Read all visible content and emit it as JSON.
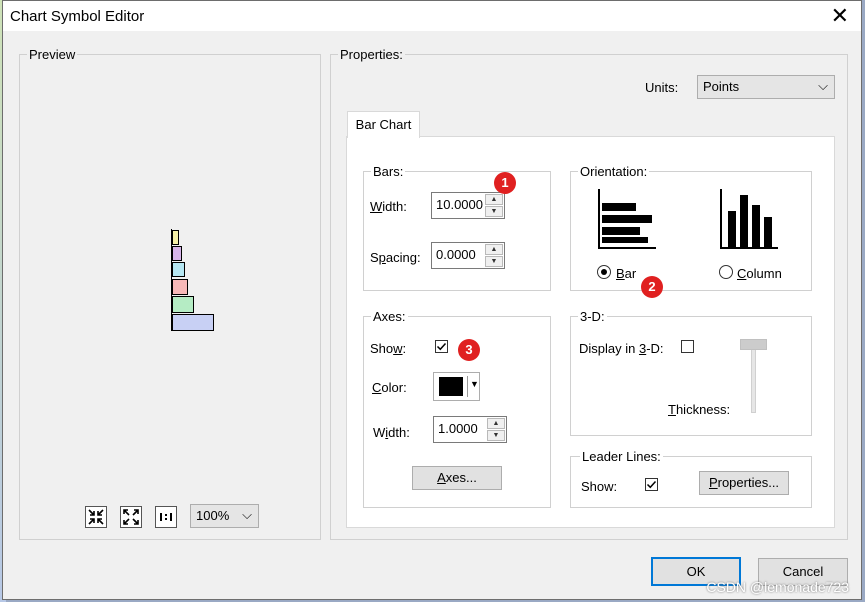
{
  "window": {
    "title": "Chart Symbol Editor"
  },
  "preview": {
    "legend": "Preview",
    "zoom": "100%",
    "bar_colors": [
      "#f5f0a8",
      "#d7b5ea",
      "#b6e7f2",
      "#f7b8b8",
      "#b5ecc4",
      "#c8d0f4"
    ]
  },
  "properties": {
    "legend": "Properties:",
    "units_label": "Units:",
    "units_value": "Points",
    "tab": "Bar Chart"
  },
  "bars": {
    "legend": "Bars:",
    "width_label_u": "W",
    "width_label_rest": "idth:",
    "width_value": "10.0000",
    "spacing_label_pre": "S",
    "spacing_label_u": "p",
    "spacing_label_rest": "acing:",
    "spacing_value": "0.0000"
  },
  "orientation": {
    "legend": "Orientation:",
    "bar_label_u": "B",
    "bar_label_rest": "ar",
    "column_label_pre": "",
    "column_label_u": "C",
    "column_label_rest": "olumn",
    "selected": "Bar"
  },
  "axes": {
    "legend": "Axes:",
    "show_label_pre": "Sho",
    "show_label_u": "w",
    "show_label_rest": ":",
    "color_label_u": "C",
    "color_label_rest": "olor:",
    "color_value": "#000000",
    "width_label_pre": "W",
    "width_label_u": "i",
    "width_label_rest": "dth:",
    "width_value": "1.0000",
    "button_u": "A",
    "button_rest": "xes..."
  },
  "three_d": {
    "legend": "3-D:",
    "display_label_pre": "Display in ",
    "display_label_u": "3",
    "display_label_rest": "-D:",
    "thickness_label_u": "T",
    "thickness_label_rest": "hickness:"
  },
  "leader_lines": {
    "legend": "Leader Lines:",
    "show_label": "Show:",
    "button_u": "P",
    "button_rest": "roperties..."
  },
  "badges": [
    "1",
    "2",
    "3"
  ],
  "footer": {
    "ok": "OK",
    "cancel": "Cancel"
  },
  "watermark": "CSDN @lemonade723"
}
